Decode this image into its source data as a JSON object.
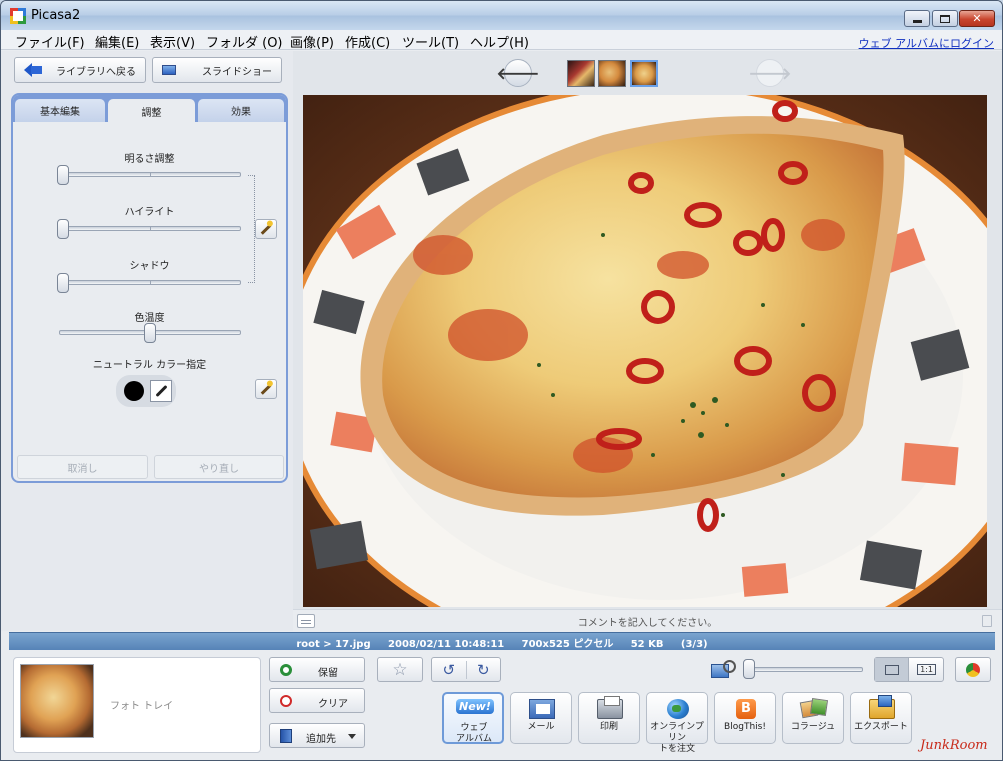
{
  "window": {
    "title": "Picasa2",
    "icons": {
      "app": "picasa-app-icon",
      "minimize": "minimize-icon",
      "maximize": "maximize-icon",
      "close": "close-icon"
    }
  },
  "menu": {
    "items": [
      "ファイル(F)",
      "編集(E)",
      "表示(V)",
      "フォルダ (O)",
      "画像(P)",
      "作成(C)",
      "ツール(T)",
      "ヘルプ(H)"
    ],
    "login_link": "ウェブ アルバムにログイン"
  },
  "left_panel": {
    "back_button": "ライブラリへ戻る",
    "slideshow_button": "スライドショー",
    "tabs": [
      {
        "label": "基本編集",
        "active": false
      },
      {
        "label": "調整",
        "active": true
      },
      {
        "label": "効果",
        "active": false
      }
    ],
    "sliders": [
      {
        "label": "明るさ調整",
        "value": 0
      },
      {
        "label": "ハイライト",
        "value": 0
      },
      {
        "label": "シャドウ",
        "value": 0
      },
      {
        "label": "色温度",
        "value": 0.5
      }
    ],
    "neutral_label": "ニュートラル カラー指定",
    "undo_button": "取消し",
    "redo_button": "やり直し"
  },
  "viewer": {
    "comment_placeholder": "コメントを記入してください。",
    "filmstrip_count": 3,
    "selected_thumb": 3
  },
  "info_bar": {
    "text": "root > 17.jpg     2008/02/11 10:48:11     700x525 ピクセル     52 KB     (3/3)"
  },
  "bottom": {
    "tray_label": "フォト トレイ",
    "hold_button": "保留",
    "clear_button": "クリア",
    "add_to_button": "追加先",
    "zoom_level": 0,
    "actual_size_label": "1:1",
    "actions": [
      {
        "label": "ウェブ\nアルバム",
        "icon": "web-album-icon",
        "badge": "New!"
      },
      {
        "label": "メール",
        "icon": "mail-icon"
      },
      {
        "label": "印刷",
        "icon": "printer-icon"
      },
      {
        "label": "オンラインプリン\nトを注文",
        "icon": "globe-icon"
      },
      {
        "label": "BlogThis!",
        "icon": "blogger-icon"
      },
      {
        "label": "コラージュ",
        "icon": "collage-icon"
      },
      {
        "label": "エクスポート",
        "icon": "export-icon"
      }
    ]
  },
  "watermark": "JunkRoom",
  "colors": {
    "accent_blue": "#7c9cd8",
    "info_bar": "#5683b7",
    "close_red": "#c9452e"
  }
}
